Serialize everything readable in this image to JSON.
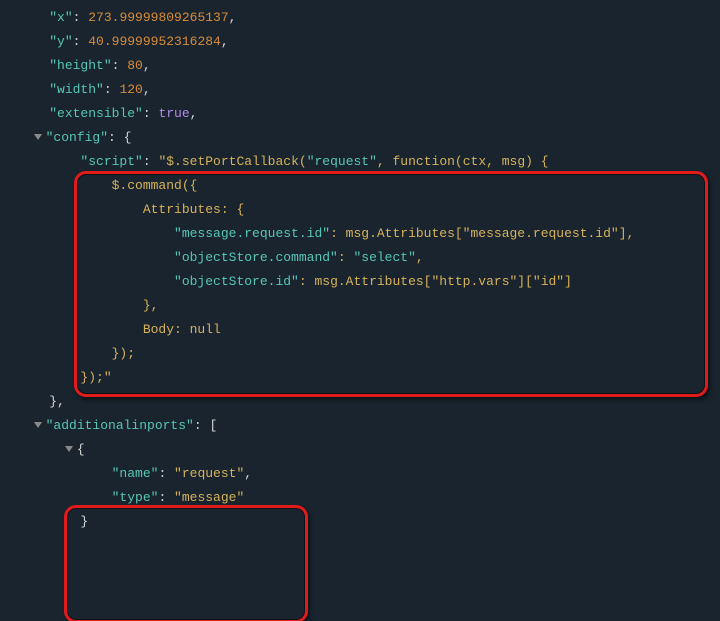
{
  "x_key": "\"x\"",
  "x_val": "273.99999809265137",
  "y_key": "\"y\"",
  "y_val": "40.99999952316284",
  "h_key": "\"height\"",
  "h_val": "80",
  "w_key": "\"width\"",
  "w_val": "120",
  "e_key": "\"extensible\"",
  "e_val": "true",
  "cfg_key": "\"config\"",
  "script_key": "\"script\"",
  "script_prefix": "\"$.setPortCallback(",
  "script_req": "\"request\"",
  "script_after_req": ", function(ctx, msg) {",
  "s_cmd": "$.command({",
  "s_attrs": "Attributes: {",
  "s_mri_key": "\"message.request.id\"",
  "s_mri_val": ": msg.Attributes[\"message.request.id\"],",
  "s_osc_key": "\"objectStore.command\"",
  "s_osc_val": ": ",
  "s_osc_sel": "\"select\"",
  "s_osc_tail": ",",
  "s_osi_key": "\"objectStore.id\"",
  "s_osi_val": ": msg.Attributes[\"http.vars\"][\"id\"]",
  "s_attrs_close": "},",
  "s_body": "Body: null",
  "s_cmd_close": "});",
  "s_fn_close": "});\"",
  "cfg_close": "},",
  "addl_key": "\"additionalinports\"",
  "name_key": "\"name\"",
  "name_val": "\"request\"",
  "type_key": "\"type\"",
  "type_val": "\"message\""
}
